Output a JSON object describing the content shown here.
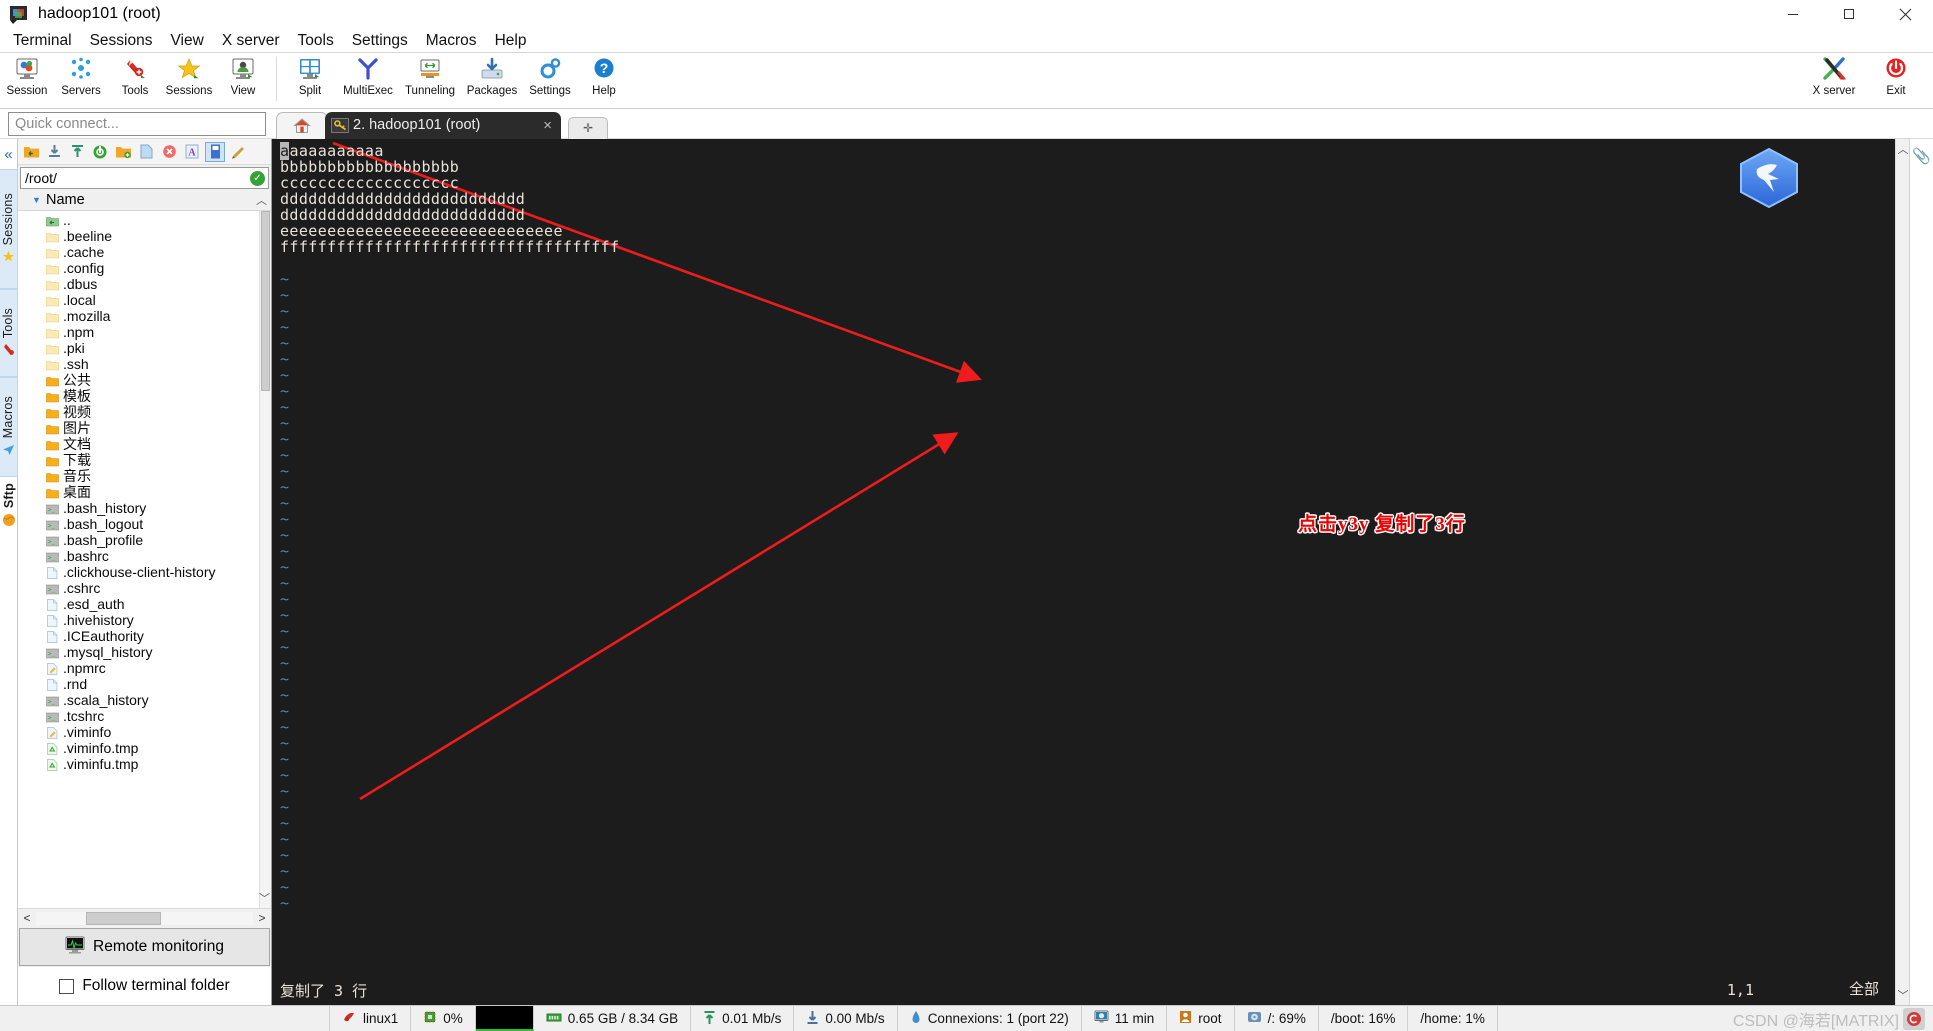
{
  "window": {
    "title": "hadoop101 (root)",
    "icon": "mobaxterm-icon",
    "buttons": {
      "minimize": "minimize-button",
      "maximize": "maximize-button",
      "close": "close-button"
    }
  },
  "menubar": {
    "items": [
      "Terminal",
      "Sessions",
      "View",
      "X server",
      "Tools",
      "Settings",
      "Macros",
      "Help"
    ]
  },
  "toolbar": {
    "items": [
      {
        "label": "Session",
        "icon": "session-icon"
      },
      {
        "label": "Servers",
        "icon": "servers-icon"
      },
      {
        "label": "Tools",
        "icon": "tools-icon"
      },
      {
        "label": "Sessions",
        "icon": "sessions-star-icon"
      },
      {
        "label": "View",
        "icon": "view-icon"
      },
      {
        "label": "Split",
        "icon": "split-icon"
      },
      {
        "label": "MultiExec",
        "icon": "multiexec-icon"
      },
      {
        "label": "Tunneling",
        "icon": "tunneling-icon"
      },
      {
        "label": "Packages",
        "icon": "packages-icon"
      },
      {
        "label": "Settings",
        "icon": "settings-gear-icon"
      },
      {
        "label": "Help",
        "icon": "help-icon"
      }
    ],
    "right_items": [
      {
        "label": "X server",
        "icon": "xserver-icon"
      },
      {
        "label": "Exit",
        "icon": "exit-power-icon"
      }
    ]
  },
  "quick_connect": {
    "placeholder": "Quick connect...",
    "value": ""
  },
  "tabs": {
    "home_tab": {
      "icon": "home-icon",
      "label": ""
    },
    "items": [
      {
        "label": "2. hadoop101 (root)",
        "icon": "ssh-key-icon",
        "active": true,
        "close": "×"
      }
    ],
    "new_tab": "+"
  },
  "rail": {
    "collapse": "«",
    "groups": [
      {
        "label": "Sessions",
        "icon": "star-icon"
      },
      {
        "label": "Tools",
        "icon": "swiss-knife-icon"
      },
      {
        "label": "Macros",
        "icon": "paper-plane-icon"
      }
    ],
    "sftp_label": "Sftp",
    "sftp_icon": "globe-icon"
  },
  "sftp": {
    "toolbar_icons": [
      "parent-folder-icon",
      "download-icon",
      "upload-icon",
      "refresh-icon",
      "new-folder-icon",
      "new-file-icon",
      "delete-icon",
      "text-mode-icon",
      "binary-mode-icon",
      "edit-icon"
    ],
    "path": "/root/",
    "path_status": "ok-check-icon",
    "column_header": "Name",
    "sort_caret": "sort-ascending-caret",
    "files": [
      {
        "name": "..",
        "icon": "parent-dir-icon"
      },
      {
        "name": ".beeline",
        "icon": "folder-hidden-icon"
      },
      {
        "name": ".cache",
        "icon": "folder-hidden-icon"
      },
      {
        "name": ".config",
        "icon": "folder-hidden-icon"
      },
      {
        "name": ".dbus",
        "icon": "folder-hidden-icon"
      },
      {
        "name": ".local",
        "icon": "folder-hidden-icon"
      },
      {
        "name": ".mozilla",
        "icon": "folder-hidden-icon"
      },
      {
        "name": ".npm",
        "icon": "folder-hidden-icon"
      },
      {
        "name": ".pki",
        "icon": "folder-hidden-icon"
      },
      {
        "name": ".ssh",
        "icon": "folder-hidden-icon"
      },
      {
        "name": "公共",
        "icon": "folder-icon"
      },
      {
        "name": "模板",
        "icon": "folder-icon"
      },
      {
        "name": "视频",
        "icon": "folder-icon"
      },
      {
        "name": "图片",
        "icon": "folder-icon"
      },
      {
        "name": "文档",
        "icon": "folder-icon"
      },
      {
        "name": "下载",
        "icon": "folder-icon"
      },
      {
        "name": "音乐",
        "icon": "folder-icon"
      },
      {
        "name": "桌面",
        "icon": "folder-icon"
      },
      {
        "name": ".bash_history",
        "icon": "script-file-icon"
      },
      {
        "name": ".bash_logout",
        "icon": "script-file-icon"
      },
      {
        "name": ".bash_profile",
        "icon": "script-file-icon"
      },
      {
        "name": ".bashrc",
        "icon": "script-file-icon"
      },
      {
        "name": ".clickhouse-client-history",
        "icon": "plain-file-icon"
      },
      {
        "name": ".cshrc",
        "icon": "script-file-icon"
      },
      {
        "name": ".esd_auth",
        "icon": "plain-file-icon"
      },
      {
        "name": ".hivehistory",
        "icon": "plain-file-icon"
      },
      {
        "name": ".ICEauthority",
        "icon": "plain-file-icon"
      },
      {
        "name": ".mysql_history",
        "icon": "script-file-icon"
      },
      {
        "name": ".npmrc",
        "icon": "edit-file-icon"
      },
      {
        "name": ".rnd",
        "icon": "plain-file-icon"
      },
      {
        "name": ".scala_history",
        "icon": "script-file-icon"
      },
      {
        "name": ".tcshrc",
        "icon": "script-file-icon"
      },
      {
        "name": ".viminfo",
        "icon": "edit-file-icon"
      },
      {
        "name": ".viminfo.tmp",
        "icon": "temp-file-icon"
      },
      {
        "name": ".viminfu.tmp",
        "icon": "temp-file-icon"
      }
    ],
    "scroll_left": "<",
    "scroll_right": ">",
    "remote_monitoring": {
      "label": "Remote monitoring",
      "icon": "monitor-graph-icon"
    },
    "follow_terminal_folder": {
      "label": "Follow terminal folder",
      "checked": false
    }
  },
  "terminal": {
    "lines": [
      "aaaaaaaaaaa",
      "bbbbbbbbbbbbbbbbbbb",
      "ccccccccccccccccccc",
      "dddddddddddddddddddddddddd",
      "dddddddddddddddddddddddddd",
      "eeeeeeeeeeeeeeeeeeeeeeeeeeeeee",
      "ffffffffffffffffffffffffffffffffffff"
    ],
    "cursor_char": "a",
    "tilde_char": "~",
    "tilde_count": 40,
    "message": "复制了 3 行",
    "position": "1,1",
    "scroll_state": "全部",
    "watermark": "mobaxterm-bird-logo",
    "colors": {
      "background": "#1c1c1c",
      "foreground": "#e8e2d8",
      "tilde": "#3d8fb5",
      "cursor": "#b8b8b8"
    }
  },
  "annotations": [
    {
      "text": "点击y3y  复制了3行",
      "color": "#ee0000",
      "outline": "#ffffff"
    }
  ],
  "statusbar": {
    "items": [
      {
        "label": "linux1",
        "icon": "linux-hat-icon"
      },
      {
        "label": "0%",
        "icon": "cpu-icon"
      },
      {
        "label": "",
        "icon": "cpu-graph-icon"
      },
      {
        "label": "0.65 GB / 8.34 GB",
        "icon": "ram-icon"
      },
      {
        "label": "0.01 Mb/s",
        "icon": "upload-arrow-icon"
      },
      {
        "label": "0.00 Mb/s",
        "icon": "download-arrow-icon"
      },
      {
        "label": "Connexions: 1 (port 22)",
        "icon": "connection-icon"
      },
      {
        "label": "11 min",
        "icon": "uptime-icon"
      },
      {
        "label": "root",
        "icon": "user-icon"
      },
      {
        "label": "/: 69%",
        "icon": "disk-icon"
      },
      {
        "label": "/boot: 16%",
        "icon": ""
      },
      {
        "label": "/home: 1%",
        "icon": ""
      }
    ],
    "watermark": "CSDN @海若[MATRIX]"
  }
}
